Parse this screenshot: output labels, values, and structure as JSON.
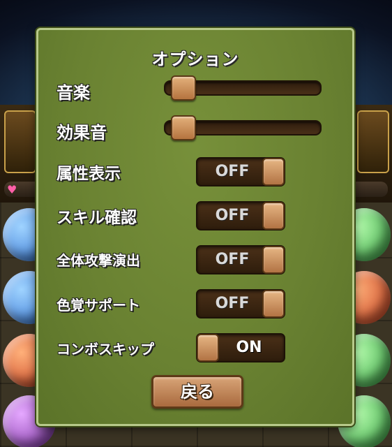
{
  "dialog": {
    "title": "オプション",
    "settings": [
      {
        "label": "音楽",
        "type": "slider",
        "level": 0.1
      },
      {
        "label": "効果音",
        "type": "slider",
        "level": 0.1
      },
      {
        "label": "属性表示",
        "type": "toggle",
        "state": "OFF"
      },
      {
        "label": "スキル確認",
        "type": "toggle",
        "state": "OFF"
      },
      {
        "label": "全体攻撃演出",
        "type": "toggle",
        "state": "OFF"
      },
      {
        "label": "色覚サポート",
        "type": "toggle",
        "state": "OFF"
      },
      {
        "label": "コンボスキップ",
        "type": "toggle",
        "state": "ON"
      }
    ],
    "back_label": "戻る"
  },
  "colors": {
    "panel": "#6a8232",
    "panel_border": "#b7c98a",
    "toggle_track": "#3a2512",
    "knob": "#c98c57"
  }
}
